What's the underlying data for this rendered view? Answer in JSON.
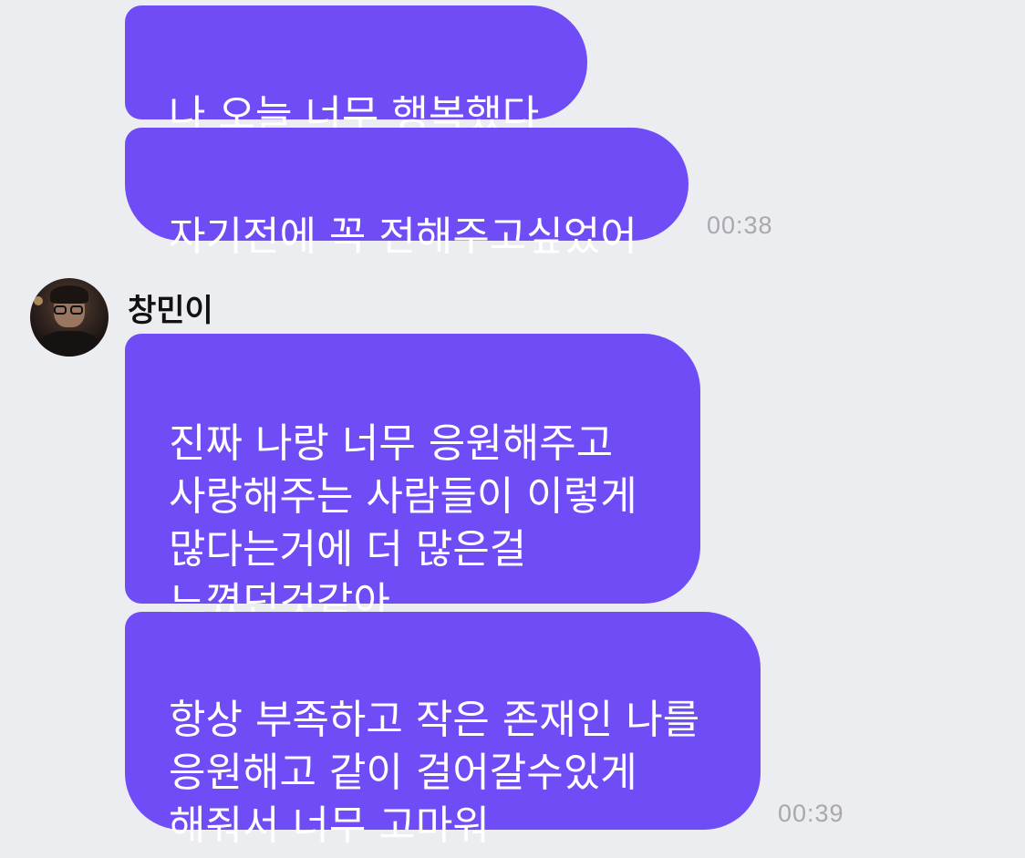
{
  "conversation": {
    "messages": [
      {
        "text": "나 오늘 너무 행복했다"
      },
      {
        "text": "자기전에 꼭 전해주고싶었어",
        "time": "00:38"
      }
    ],
    "sender": {
      "name": "창민이",
      "messages": [
        {
          "text": "진짜 나랑 너무 응원해주고\n사랑해주는 사람들이 이렇게\n많다는거에 더 많은걸\n느꼈던것같아"
        },
        {
          "text": "항상 부족하고 작은 존재인 나를\n응원해고 같이 걸어갈수있게\n해줘서 너무 고마워",
          "time": "00:39"
        }
      ]
    }
  },
  "colors": {
    "background": "#ecedf1",
    "bubble": "#704cf7",
    "bubble_text": "#ffffff",
    "timestamp": "#a8a8ad"
  }
}
